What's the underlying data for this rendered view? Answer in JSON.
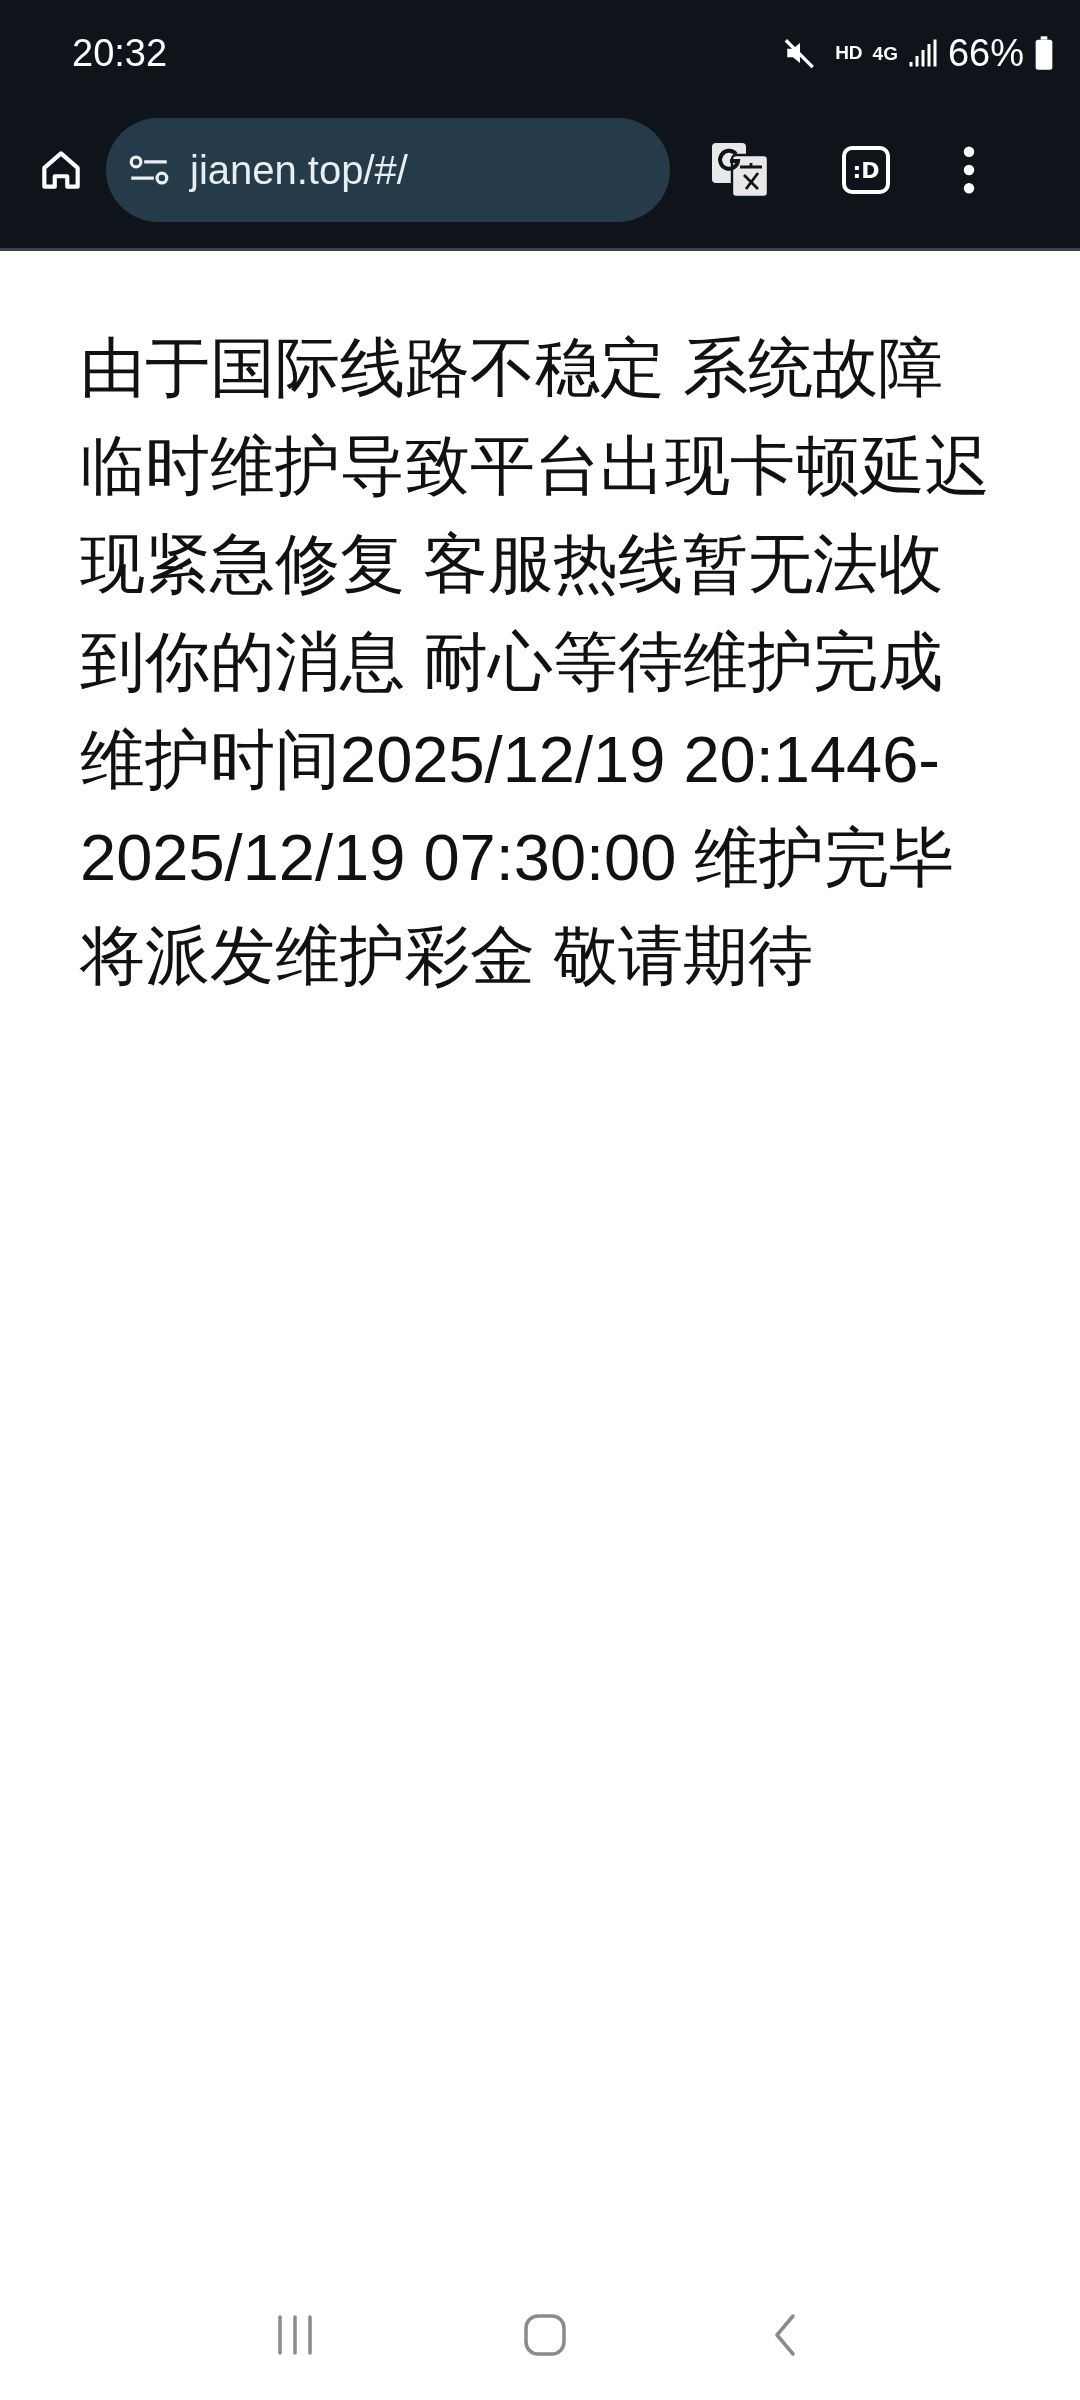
{
  "status_bar": {
    "time": "20:32",
    "hd_label": "HD",
    "network_label": "4G",
    "battery": "66%"
  },
  "browser_toolbar": {
    "url": "jianen.top/#/",
    "tab_switcher": ":D"
  },
  "page": {
    "message": "由于国际线路不稳定 系统故障临时维护导致平台出现卡顿延迟现紧急修复 客服热线暂无法收到你的消息 耐心等待维护完成维护时间2025/12/19 20:1446-2025/12/19 07:30:00 维护完毕将派发维护彩金 敬请期待"
  }
}
